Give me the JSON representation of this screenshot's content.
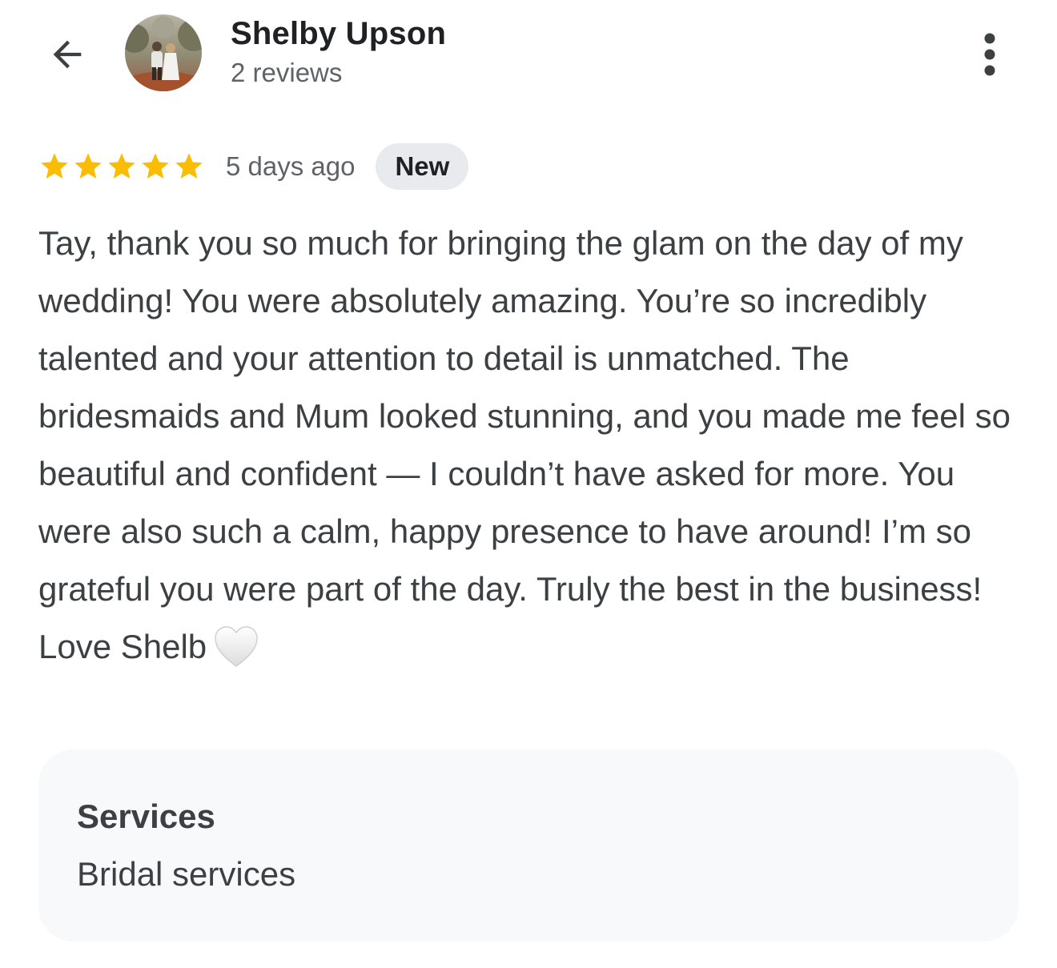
{
  "header": {
    "back_icon": "arrow-back-icon",
    "avatar_icon": "reviewer-avatar-photo",
    "reviewer_name": "Shelby Upson",
    "review_count": "2 reviews",
    "more_icon": "more-vert-icon"
  },
  "review": {
    "rating": 5,
    "rating_max": 5,
    "star_color": "#fbbc04",
    "time_ago": "5 days ago",
    "badge": "New",
    "text": "Tay, thank you so much for bringing the glam on the day of my wedding! You were absolutely amazing. You’re so incredibly talented and your attention to detail is unmatched. The bridesmaids and Mum looked stunning, and you made me feel so beautiful and confident — I couldn’t have asked for more. You were also such a calm, happy presence to have around! I’m so grateful you were part of the day. Truly the best in the business! Love Shelb",
    "text_emoji_icon": "white-heart-icon"
  },
  "services": {
    "title": "Services",
    "value": "Bridal services"
  }
}
